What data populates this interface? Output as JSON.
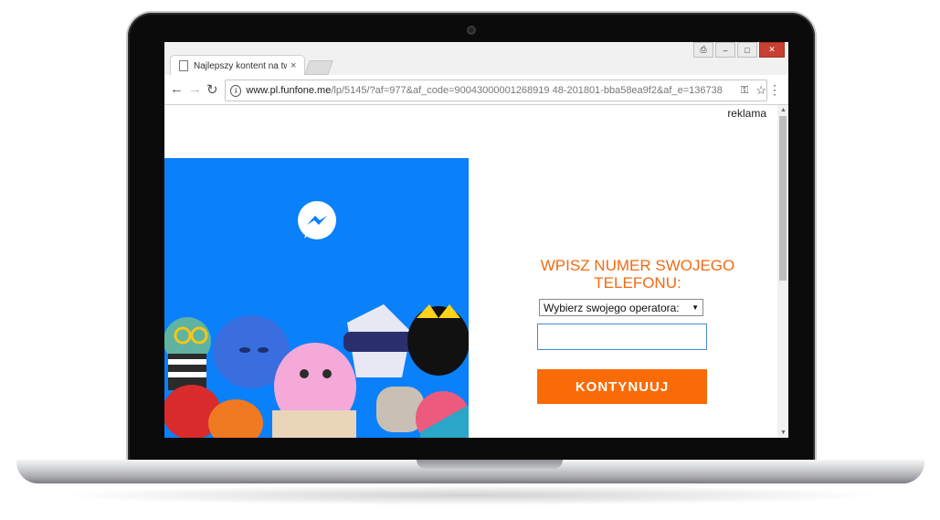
{
  "browser": {
    "tab_title": "Najlepszy kontent na tw",
    "tab_close": "×",
    "window_buttons": {
      "user": "⎙",
      "minimize": "–",
      "maximize": "□",
      "close": "✕"
    },
    "nav": {
      "back": "←",
      "forward": "→",
      "reload": "↻",
      "menu": "⋮"
    },
    "url_host": "www.pl.funfone.me",
    "url_path": "/lp/5145/?af=977&af_code=90043000001268919 48-201801-bba58ea9f2&af_e=136738",
    "key_icon": "⚿",
    "star_icon": "☆"
  },
  "page": {
    "reklama": "reklama",
    "form_title": "WPISZ NUMER SWOJEGO TELEFONU:",
    "operator_select": "Wybierz swojego operatora:",
    "phone_placeholder": "",
    "cta_label": "KONTYNUUJ"
  },
  "colors": {
    "banner_blue": "#0a80fa",
    "title_orange": "#f26a13",
    "cta_orange": "#f96b07"
  }
}
